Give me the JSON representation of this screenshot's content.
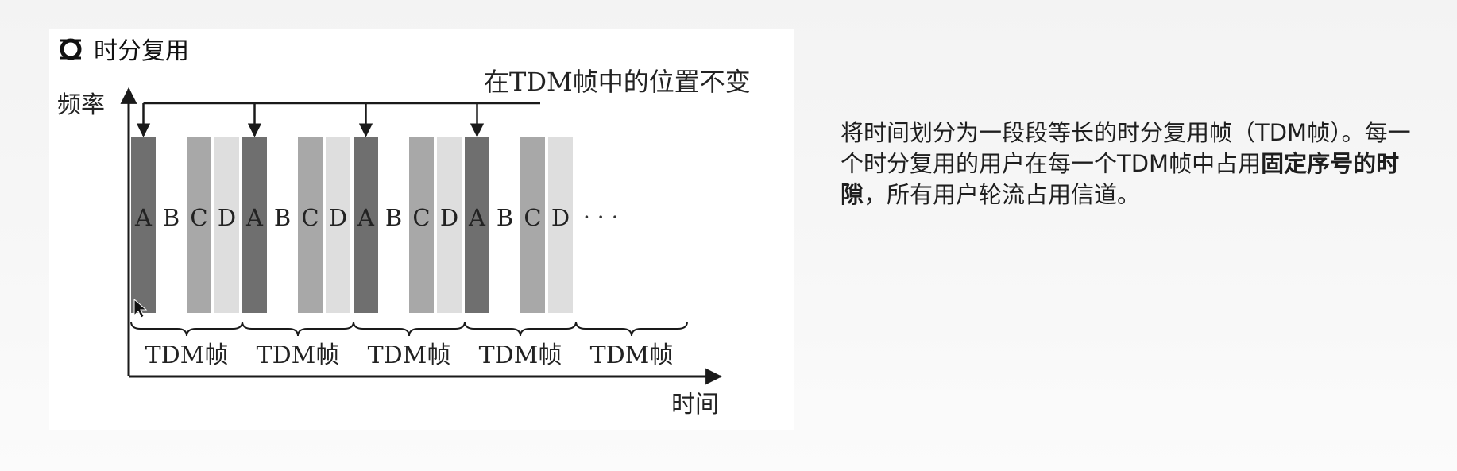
{
  "heading": {
    "icon": "interlock-rings-icon",
    "title": "时分复用"
  },
  "diagram": {
    "y_axis_label": "频率",
    "x_axis_label": "时间",
    "position_note": "在TDM帧中的位置不变",
    "slot_labels": [
      "A",
      "B",
      "C",
      "D"
    ],
    "frame_label": "TDM帧",
    "frames_drawn": 4,
    "frame_braces": 5,
    "ellipsis": "· · ·",
    "colors": {
      "A": "#6f6f6f",
      "B": "#ffffff",
      "C": "#a8a8a8",
      "D": "#dedede",
      "line": "#1a1a1a"
    }
  },
  "description": {
    "part1": "将时间划分为一段段等长的时分复用帧（TDM帧）。每一个时分复用的用户在每一个TDM帧中占用",
    "bold": "固定序号的时隙",
    "part2": "，所有用户轮流占用信道。"
  }
}
